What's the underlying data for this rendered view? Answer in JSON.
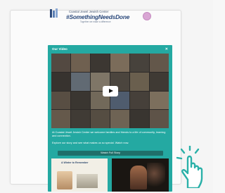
{
  "brand": {
    "tagline": "Coastal Jewel Jewish Center",
    "hashtag": "#SomethingNeedsDone",
    "subline": "Together we make a difference"
  },
  "panel": {
    "title": "Our Video",
    "close_symbol": "✕",
    "text_1": "At Coastal Jewel Jewish Center we welcome families and friends to a life of community, learning and connection.",
    "text_2": "Explore our story and see what makes us so special. Watch now.",
    "cta_label": "Watch Full Story",
    "tile_left_title": "A Winter to Remember"
  },
  "colors": {
    "panel": "#24a9a2",
    "cta": "#1f6f6a",
    "badge": "#d9a6d4",
    "hand": "#2ab0a8"
  },
  "icons": {
    "play": "play-icon",
    "close": "close-icon",
    "pointer": "pointer-hand-icon",
    "badge": "badge-icon",
    "logo": "logo-icon"
  }
}
